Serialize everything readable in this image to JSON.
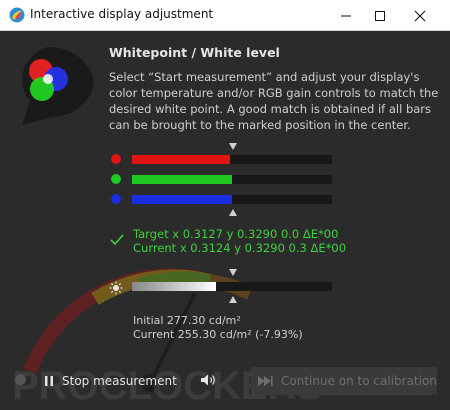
{
  "window": {
    "title": "Interactive display adjustment"
  },
  "header": {
    "title": "Whitepoint / White level",
    "description": "Select “Start measurement” and adjust your display's color temperature and/or RGB gain controls to match the desired white point. A good match is obtained if all bars can be brought to the marked position in the center."
  },
  "channels": [
    {
      "name": "red",
      "color": "#e01414",
      "level": 0.49
    },
    {
      "name": "green",
      "color": "#1ec81e",
      "level": 0.5
    },
    {
      "name": "blue",
      "color": "#1a2ee0",
      "level": 0.5
    }
  ],
  "measurement": {
    "target": "Target x 0.3127 y 0.3290 0.0 ΔE*00",
    "current": "Current x 0.3124 y 0.3290 0.3 ΔE*00",
    "color": "#3dd23d"
  },
  "brightness": {
    "icon": "sun-icon",
    "level": 0.42
  },
  "luminance": {
    "initial": "Initial 277.30 cd/m²",
    "current": "Current 255.30 cd/m² (-7.93%)"
  },
  "buttons": {
    "stop": "Stop measurement",
    "continue": "Continue on to calibration"
  },
  "icons": {
    "app": "app-logo-icon",
    "rgb": "rgb-circles-icon",
    "check": "check-icon",
    "pause": "pause-icon",
    "speaker": "speaker-icon",
    "skip": "skip-forward-icon"
  }
}
